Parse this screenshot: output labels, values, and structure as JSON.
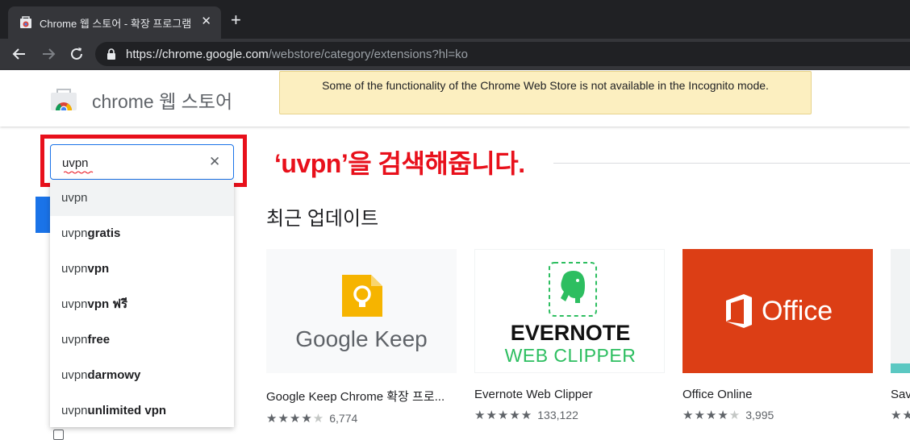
{
  "browser": {
    "tab_title": "Chrome 웹 스토어 - 확장 프로그램",
    "tab_close": "✕",
    "new_tab": "+",
    "url_host": "https://chrome.google.com",
    "url_path": "/webstore/category/extensions?hl=ko"
  },
  "store": {
    "name": "chrome 웹 스토어",
    "incognito_notice": "Some of the functionality of the Chrome Web Store is not available in the Incognito mode."
  },
  "search": {
    "value": "uvpn",
    "clear": "✕",
    "suggestions": [
      {
        "typed": "uvpn",
        "completion": ""
      },
      {
        "typed": "uvpn",
        "completion": "gratis"
      },
      {
        "typed": "uvpn",
        "completion": "vpn"
      },
      {
        "typed": "uvpn",
        "completion": "vpn ฟรี"
      },
      {
        "typed": "uvpn",
        "completion": "free"
      },
      {
        "typed": "uvpn",
        "completion": "darmowy"
      },
      {
        "typed": "uvpn",
        "completion": "unlimited vpn"
      }
    ]
  },
  "annotation": "‘uvpn’을 검색해줍니다.",
  "section": {
    "title": "최근 업데이트"
  },
  "cards": [
    {
      "name": "Google Keep Chrome 확장 프로...",
      "stars": "★★★★",
      "stars_off": "★",
      "rating_count": "6,774",
      "logo_text": "Google Keep"
    },
    {
      "name": "Evernote Web Clipper",
      "stars": "★★★★★",
      "stars_off": "",
      "rating_count": "133,122",
      "logo_text": "EVERNOTE",
      "logo_sub": "WEB CLIPPER"
    },
    {
      "name": "Office Online",
      "stars": "★★★★",
      "stars_off": "★",
      "rating_count": "3,995",
      "logo_text": "Office"
    },
    {
      "name": "Sav",
      "stars": "★★",
      "stars_off": "",
      "rating_count": ""
    }
  ],
  "colors": {
    "accent": "#1a73e8",
    "annotation_red": "#e8101b",
    "office_red": "#dc3e15",
    "evernote_green": "#2dbe60",
    "keep_yellow": "#f6b400"
  }
}
